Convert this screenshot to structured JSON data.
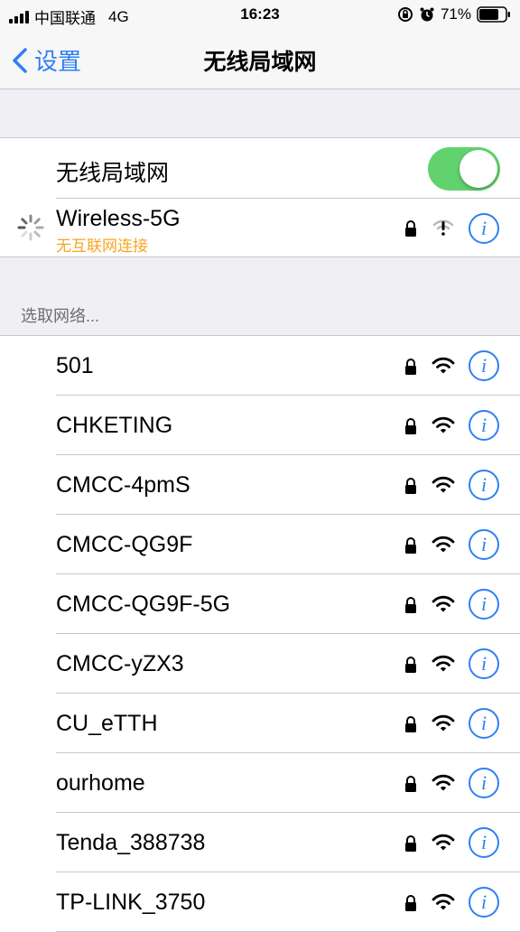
{
  "status_bar": {
    "carrier": "中国联通",
    "network": "4G",
    "time": "16:23",
    "battery": "71%"
  },
  "nav": {
    "back_label": "设置",
    "title": "无线局域网"
  },
  "wifi_toggle": {
    "label": "无线局域网",
    "on": true
  },
  "current_network": {
    "name": "Wireless-5G",
    "status": "无互联网连接",
    "status_color": "#f5a623"
  },
  "section_header": "选取网络...",
  "networks": [
    {
      "name": "501"
    },
    {
      "name": "CHKETING"
    },
    {
      "name": "CMCC-4pmS"
    },
    {
      "name": "CMCC-QG9F"
    },
    {
      "name": "CMCC-QG9F-5G"
    },
    {
      "name": "CMCC-yZX3"
    },
    {
      "name": "CU_eTTH"
    },
    {
      "name": "ourhome"
    },
    {
      "name": "Tenda_388738"
    },
    {
      "name": "TP-LINK_3750"
    }
  ],
  "info_glyph": "i",
  "colors": {
    "accent": "#2f7ff5",
    "toggle_on": "#62d26f"
  }
}
